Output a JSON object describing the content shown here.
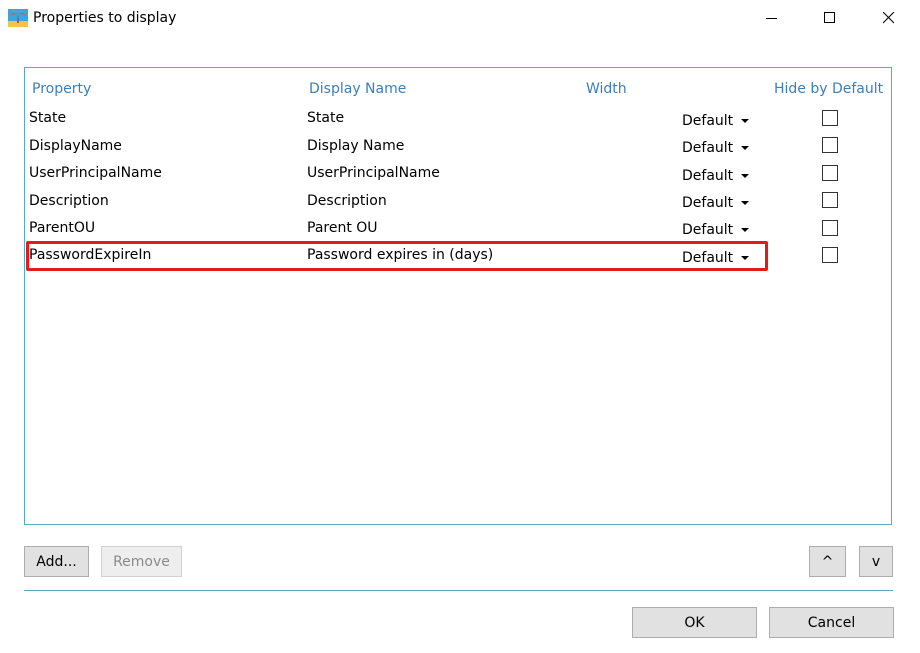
{
  "window": {
    "title": "Properties to display",
    "icons": [
      "palm-tree-icon",
      "minimize-icon",
      "maximize-icon",
      "close-icon"
    ]
  },
  "grid": {
    "columns": [
      "Property",
      "Display Name",
      "Width",
      "Hide by Default"
    ],
    "rows": [
      {
        "property": "State",
        "display_name": "State",
        "width": "Default",
        "hide": false
      },
      {
        "property": "DisplayName",
        "display_name": "Display Name",
        "width": "Default",
        "hide": false
      },
      {
        "property": "UserPrincipalName",
        "display_name": "UserPrincipalName",
        "width": "Default",
        "hide": false
      },
      {
        "property": "Description",
        "display_name": "Description",
        "width": "Default",
        "hide": false
      },
      {
        "property": "ParentOU",
        "display_name": "Parent OU",
        "width": "Default",
        "hide": false
      },
      {
        "property": "PasswordExpireIn",
        "display_name": "Password expires in (days)",
        "width": "Default",
        "hide": false
      }
    ],
    "highlight_color": "#e41b1b",
    "header_color": "#3e7fb3",
    "border_color": "#5aa9c4"
  },
  "buttons": {
    "add": "Add...",
    "remove": "Remove",
    "move_up": "^",
    "move_down": "v",
    "ok": "OK",
    "cancel": "Cancel"
  }
}
